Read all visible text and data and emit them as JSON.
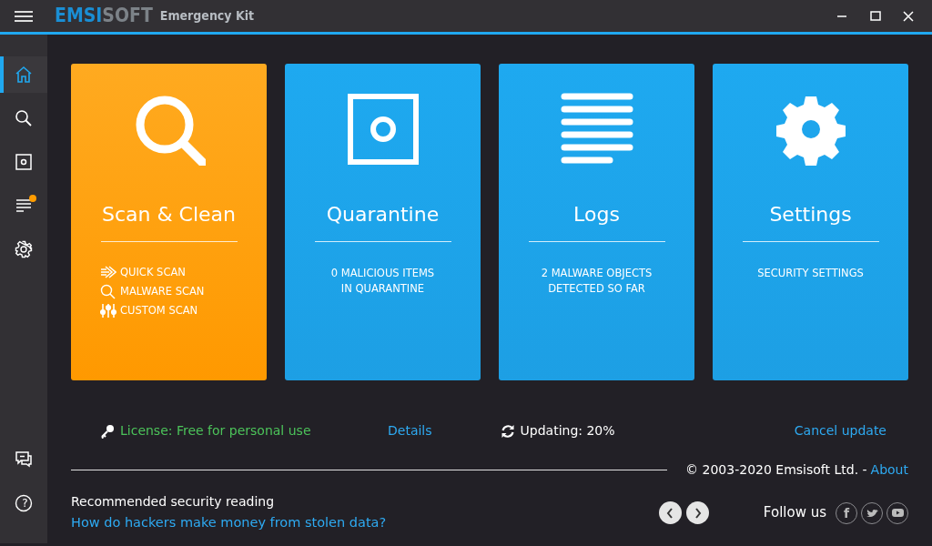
{
  "window": {
    "logo": [
      "EMSI",
      "SOFT"
    ],
    "product": "Emergency Kit"
  },
  "sidebar": {
    "top_items": [
      {
        "kind": "home",
        "selected": true,
        "notification": false
      },
      {
        "kind": "search",
        "selected": false,
        "notification": false
      },
      {
        "kind": "quarantine",
        "selected": false,
        "notification": false
      },
      {
        "kind": "logs",
        "selected": false,
        "notification": true
      },
      {
        "kind": "settings",
        "selected": false,
        "notification": false
      }
    ],
    "bottom_items": [
      {
        "kind": "chat",
        "selected": false,
        "notification": false
      },
      {
        "kind": "help",
        "glyph": "?",
        "selected": false,
        "notification": false
      }
    ]
  },
  "tiles": [
    {
      "kind": "scan",
      "highlighted": true,
      "title": "Scan & Clean",
      "actions": [
        {
          "kind": "quick",
          "label": "QUICK SCAN"
        },
        {
          "kind": "malware",
          "label": "MALWARE SCAN"
        },
        {
          "kind": "custom",
          "label": "CUSTOM SCAN"
        }
      ]
    },
    {
      "kind": "quarantine",
      "highlighted": false,
      "title": "Quarantine",
      "description": "0 MALICIOUS ITEMS\nIN QUARANTINE"
    },
    {
      "kind": "logs",
      "highlighted": false,
      "title": "Logs",
      "description": "2 MALWARE OBJECTS\nDETECTED SO FAR"
    },
    {
      "kind": "settings",
      "highlighted": false,
      "title": "Settings",
      "description": "SECURITY SETTINGS"
    }
  ],
  "status": {
    "license": "License: Free for personal use",
    "details_link": "Details",
    "update": "Updating: 20%",
    "cancel_link": "Cancel update"
  },
  "footer": {
    "copyright": "© 2003-2020 Emsisoft Ltd. -",
    "about_link": "About",
    "reading_label": "Recommended security reading",
    "reading_link": "How do hackers make money from stolen data?",
    "follow": "Follow us",
    "social": [
      {
        "kind": "facebook",
        "glyph": "f"
      },
      {
        "kind": "twitter"
      },
      {
        "kind": "youtube"
      }
    ]
  }
}
